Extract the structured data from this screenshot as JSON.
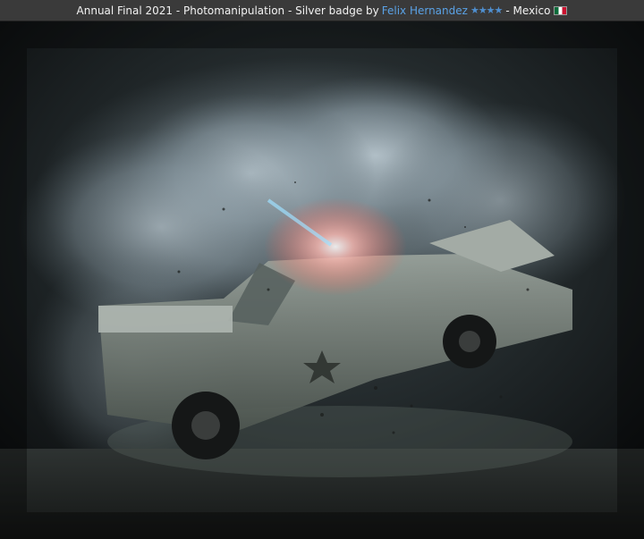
{
  "caption": {
    "prefix": "Annual Final 2021 - Photomanipulation - Silver badge by",
    "author": "Felix Hernandez",
    "stars": "★★★★",
    "separator": "- Mexico"
  },
  "artwork": {
    "alt": "Photomanipulation of a police car exploding into the air amid smoke and debris",
    "badge_color": "#c0c0c0",
    "flag_icon": "mexico-flag-icon"
  }
}
